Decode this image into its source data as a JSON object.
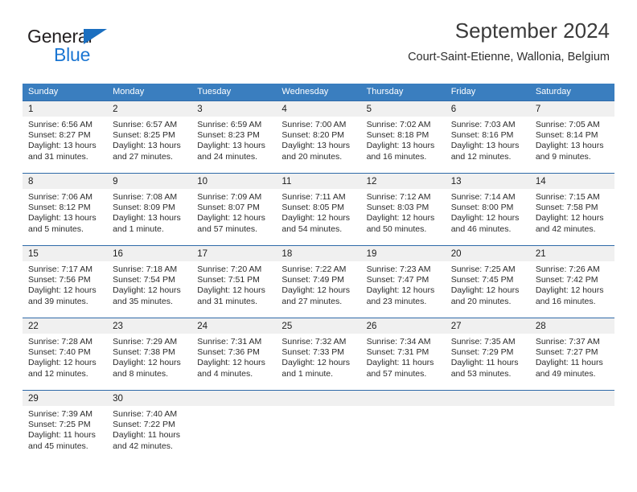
{
  "brand": {
    "name_top": "General",
    "name_bottom": "Blue",
    "color_dark": "#231f20",
    "color_blue": "#1b76d2"
  },
  "header": {
    "title": "September 2024",
    "subtitle": "Court-Saint-Etienne, Wallonia, Belgium"
  },
  "theme": {
    "header_bg": "#3a7ebf",
    "row_divider": "#2f6aa8",
    "day_band_bg": "#f0f0f0",
    "text": "#2b2b2b"
  },
  "weekdays": [
    "Sunday",
    "Monday",
    "Tuesday",
    "Wednesday",
    "Thursday",
    "Friday",
    "Saturday"
  ],
  "weeks": [
    [
      {
        "day": "1",
        "line1": "Sunrise: 6:56 AM",
        "line2": "Sunset: 8:27 PM",
        "line3": "Daylight: 13 hours",
        "line4": "and 31 minutes."
      },
      {
        "day": "2",
        "line1": "Sunrise: 6:57 AM",
        "line2": "Sunset: 8:25 PM",
        "line3": "Daylight: 13 hours",
        "line4": "and 27 minutes."
      },
      {
        "day": "3",
        "line1": "Sunrise: 6:59 AM",
        "line2": "Sunset: 8:23 PM",
        "line3": "Daylight: 13 hours",
        "line4": "and 24 minutes."
      },
      {
        "day": "4",
        "line1": "Sunrise: 7:00 AM",
        "line2": "Sunset: 8:20 PM",
        "line3": "Daylight: 13 hours",
        "line4": "and 20 minutes."
      },
      {
        "day": "5",
        "line1": "Sunrise: 7:02 AM",
        "line2": "Sunset: 8:18 PM",
        "line3": "Daylight: 13 hours",
        "line4": "and 16 minutes."
      },
      {
        "day": "6",
        "line1": "Sunrise: 7:03 AM",
        "line2": "Sunset: 8:16 PM",
        "line3": "Daylight: 13 hours",
        "line4": "and 12 minutes."
      },
      {
        "day": "7",
        "line1": "Sunrise: 7:05 AM",
        "line2": "Sunset: 8:14 PM",
        "line3": "Daylight: 13 hours",
        "line4": "and 9 minutes."
      }
    ],
    [
      {
        "day": "8",
        "line1": "Sunrise: 7:06 AM",
        "line2": "Sunset: 8:12 PM",
        "line3": "Daylight: 13 hours",
        "line4": "and 5 minutes."
      },
      {
        "day": "9",
        "line1": "Sunrise: 7:08 AM",
        "line2": "Sunset: 8:09 PM",
        "line3": "Daylight: 13 hours",
        "line4": "and 1 minute."
      },
      {
        "day": "10",
        "line1": "Sunrise: 7:09 AM",
        "line2": "Sunset: 8:07 PM",
        "line3": "Daylight: 12 hours",
        "line4": "and 57 minutes."
      },
      {
        "day": "11",
        "line1": "Sunrise: 7:11 AM",
        "line2": "Sunset: 8:05 PM",
        "line3": "Daylight: 12 hours",
        "line4": "and 54 minutes."
      },
      {
        "day": "12",
        "line1": "Sunrise: 7:12 AM",
        "line2": "Sunset: 8:03 PM",
        "line3": "Daylight: 12 hours",
        "line4": "and 50 minutes."
      },
      {
        "day": "13",
        "line1": "Sunrise: 7:14 AM",
        "line2": "Sunset: 8:00 PM",
        "line3": "Daylight: 12 hours",
        "line4": "and 46 minutes."
      },
      {
        "day": "14",
        "line1": "Sunrise: 7:15 AM",
        "line2": "Sunset: 7:58 PM",
        "line3": "Daylight: 12 hours",
        "line4": "and 42 minutes."
      }
    ],
    [
      {
        "day": "15",
        "line1": "Sunrise: 7:17 AM",
        "line2": "Sunset: 7:56 PM",
        "line3": "Daylight: 12 hours",
        "line4": "and 39 minutes."
      },
      {
        "day": "16",
        "line1": "Sunrise: 7:18 AM",
        "line2": "Sunset: 7:54 PM",
        "line3": "Daylight: 12 hours",
        "line4": "and 35 minutes."
      },
      {
        "day": "17",
        "line1": "Sunrise: 7:20 AM",
        "line2": "Sunset: 7:51 PM",
        "line3": "Daylight: 12 hours",
        "line4": "and 31 minutes."
      },
      {
        "day": "18",
        "line1": "Sunrise: 7:22 AM",
        "line2": "Sunset: 7:49 PM",
        "line3": "Daylight: 12 hours",
        "line4": "and 27 minutes."
      },
      {
        "day": "19",
        "line1": "Sunrise: 7:23 AM",
        "line2": "Sunset: 7:47 PM",
        "line3": "Daylight: 12 hours",
        "line4": "and 23 minutes."
      },
      {
        "day": "20",
        "line1": "Sunrise: 7:25 AM",
        "line2": "Sunset: 7:45 PM",
        "line3": "Daylight: 12 hours",
        "line4": "and 20 minutes."
      },
      {
        "day": "21",
        "line1": "Sunrise: 7:26 AM",
        "line2": "Sunset: 7:42 PM",
        "line3": "Daylight: 12 hours",
        "line4": "and 16 minutes."
      }
    ],
    [
      {
        "day": "22",
        "line1": "Sunrise: 7:28 AM",
        "line2": "Sunset: 7:40 PM",
        "line3": "Daylight: 12 hours",
        "line4": "and 12 minutes."
      },
      {
        "day": "23",
        "line1": "Sunrise: 7:29 AM",
        "line2": "Sunset: 7:38 PM",
        "line3": "Daylight: 12 hours",
        "line4": "and 8 minutes."
      },
      {
        "day": "24",
        "line1": "Sunrise: 7:31 AM",
        "line2": "Sunset: 7:36 PM",
        "line3": "Daylight: 12 hours",
        "line4": "and 4 minutes."
      },
      {
        "day": "25",
        "line1": "Sunrise: 7:32 AM",
        "line2": "Sunset: 7:33 PM",
        "line3": "Daylight: 12 hours",
        "line4": "and 1 minute."
      },
      {
        "day": "26",
        "line1": "Sunrise: 7:34 AM",
        "line2": "Sunset: 7:31 PM",
        "line3": "Daylight: 11 hours",
        "line4": "and 57 minutes."
      },
      {
        "day": "27",
        "line1": "Sunrise: 7:35 AM",
        "line2": "Sunset: 7:29 PM",
        "line3": "Daylight: 11 hours",
        "line4": "and 53 minutes."
      },
      {
        "day": "28",
        "line1": "Sunrise: 7:37 AM",
        "line2": "Sunset: 7:27 PM",
        "line3": "Daylight: 11 hours",
        "line4": "and 49 minutes."
      }
    ],
    [
      {
        "day": "29",
        "line1": "Sunrise: 7:39 AM",
        "line2": "Sunset: 7:25 PM",
        "line3": "Daylight: 11 hours",
        "line4": "and 45 minutes."
      },
      {
        "day": "30",
        "line1": "Sunrise: 7:40 AM",
        "line2": "Sunset: 7:22 PM",
        "line3": "Daylight: 11 hours",
        "line4": "and 42 minutes."
      },
      {
        "day": "",
        "line1": "",
        "line2": "",
        "line3": "",
        "line4": ""
      },
      {
        "day": "",
        "line1": "",
        "line2": "",
        "line3": "",
        "line4": ""
      },
      {
        "day": "",
        "line1": "",
        "line2": "",
        "line3": "",
        "line4": ""
      },
      {
        "day": "",
        "line1": "",
        "line2": "",
        "line3": "",
        "line4": ""
      },
      {
        "day": "",
        "line1": "",
        "line2": "",
        "line3": "",
        "line4": ""
      }
    ]
  ]
}
